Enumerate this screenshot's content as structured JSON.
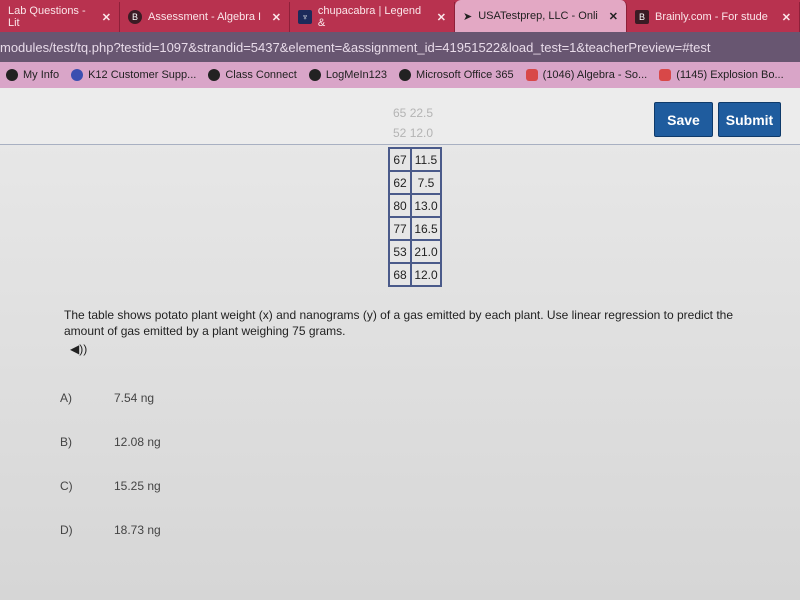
{
  "browser": {
    "tabs": [
      {
        "title": "Lab Questions - Lit",
        "icon": "tab-icon",
        "active": false
      },
      {
        "title": "Assessment - Algebra I",
        "icon": "b-logo-icon",
        "active": false
      },
      {
        "title": "chupacabra | Legend &",
        "icon": "lamp-icon",
        "active": false
      },
      {
        "title": "USATestprep, LLC - Onli",
        "icon": "cursor-icon",
        "active": true
      },
      {
        "title": "Brainly.com - For stude",
        "icon": "brainly-icon",
        "active": false
      }
    ],
    "close_glyph": "✕",
    "url": "modules/test/tq.php?testid=1097&strandid=5437&element=&assignment_id=41951522&load_test=1&teacherPreview=#test",
    "bookmarks": [
      {
        "label": "My Info",
        "icon": "globe-icon"
      },
      {
        "label": "K12 Customer Supp...",
        "icon": "cloud-icon"
      },
      {
        "label": "Class Connect",
        "icon": "globe-icon"
      },
      {
        "label": "LogMeIn123",
        "icon": "globe-icon"
      },
      {
        "label": "Microsoft Office 365",
        "icon": "globe-icon"
      },
      {
        "label": "(1046) Algebra - So...",
        "icon": "youtube-icon"
      },
      {
        "label": "(1145) Explosion Bo...",
        "icon": "youtube-icon"
      }
    ]
  },
  "header": {
    "save_label": "Save",
    "submit_label": "Submit",
    "accent": "#1f5c9e"
  },
  "table": {
    "hidden_rows": [
      [
        "65",
        "22.5"
      ],
      [
        "52",
        "12.0"
      ]
    ],
    "rows": [
      [
        "67",
        "11.5"
      ],
      [
        "62",
        "7.5"
      ],
      [
        "80",
        "13.0"
      ],
      [
        "77",
        "16.5"
      ],
      [
        "53",
        "21.0"
      ],
      [
        "68",
        "12.0"
      ]
    ]
  },
  "question": {
    "text": "The table shows potato plant weight (x) and nanograms (y) of a gas emitted by each plant. Use linear regression to predict the amount of gas emitted by a plant weighing 75 grams.",
    "speaker_glyph": "◀))",
    "options": [
      {
        "letter": "A)",
        "value": "7.54 ng"
      },
      {
        "letter": "B)",
        "value": "12.08 ng"
      },
      {
        "letter": "C)",
        "value": "15.25 ng"
      },
      {
        "letter": "D)",
        "value": "18.73 ng"
      }
    ]
  }
}
